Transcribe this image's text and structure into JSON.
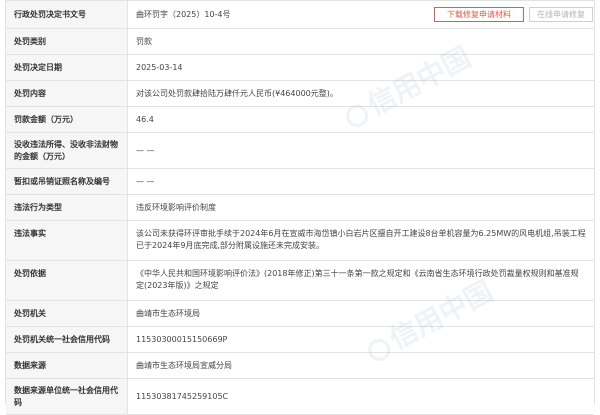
{
  "header": {
    "label": "行政处罚决定书文号",
    "value": "曲环罚字（2025）10-4号",
    "download_button": "下载修复申请材料",
    "repair_button": "在线申请修复"
  },
  "rows": [
    {
      "label": "处罚类别",
      "value": "罚款"
    },
    {
      "label": "处罚决定日期",
      "value": "2025-03-14"
    },
    {
      "label": "处罚内容",
      "value": "对该公司处罚款肆拾陆万肆仟元人民币(¥464000元整)。"
    },
    {
      "label": "罚款金额（万元）",
      "value": "46.4"
    },
    {
      "label": "没收违法所得、没收非法财物的金额（万元）",
      "value": "— —"
    },
    {
      "label": "暂扣或吊销证照名称及编号",
      "value": "— —"
    },
    {
      "label": "违法行为类型",
      "value": "违反环境影响评价制度"
    },
    {
      "label": "违法事实",
      "value": "该公司未获得环评审批手续于2024年6月在宣威市海岱镇小白岩片区擅自开工建设8台单机容量为6.25MW的风电机组,吊装工程已于2024年9月底完成,部分附属设施还未完成安装。"
    },
    {
      "label": "处罚依据",
      "value": "《中华人民共和国环境影响评价法》(2018年修正)第三十一条第一款之规定和《云南省生态环境行政处罚裁量权规则和基准规定(2023年版)》之规定"
    },
    {
      "label": "处罚机关",
      "value": "曲靖市生态环境局"
    },
    {
      "label": "处罚机关统一社会信用代码",
      "value": "11530300015150669P"
    },
    {
      "label": "数据来源",
      "value": "曲靖市生态环境局宣威分局"
    },
    {
      "label": "数据来源单位统一社会信用代码",
      "value": "11530381745259105C"
    }
  ],
  "watermark": {
    "text": "信用中国",
    "color": "#78a0c8"
  }
}
